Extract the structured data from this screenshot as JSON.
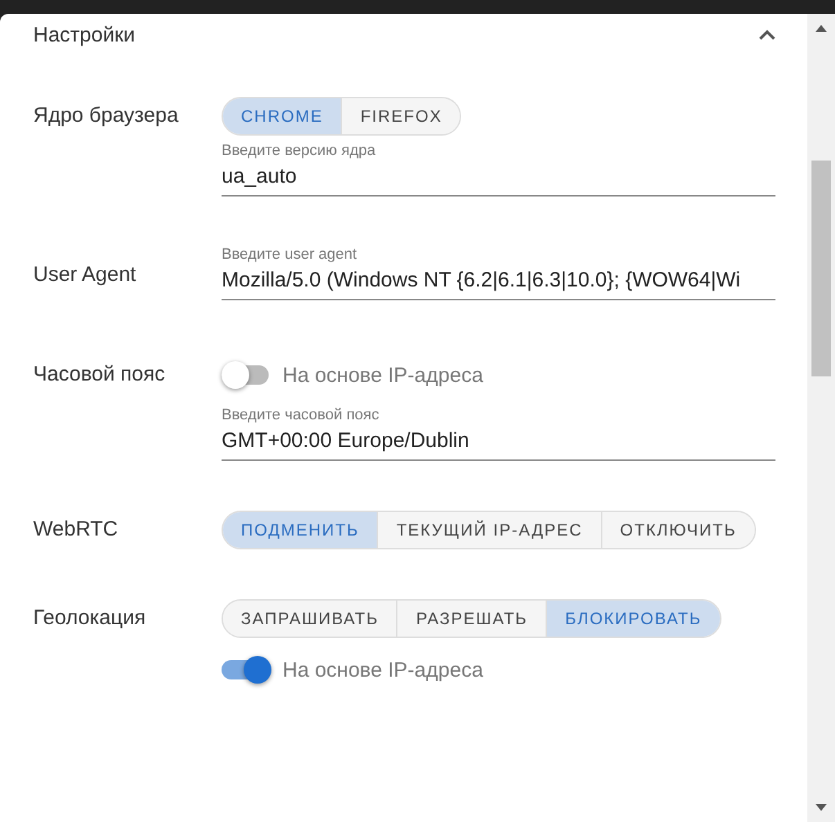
{
  "header": {
    "title": "Настройки",
    "expanded": true
  },
  "rows": [
    {
      "label": "Ядро браузера",
      "controls": [
        {
          "kind": "segmented",
          "options": [
            {
              "label": "CHROME",
              "selected": true
            },
            {
              "label": "FIREFOX",
              "selected": false
            }
          ]
        },
        {
          "kind": "field",
          "label": "Введите версию ядра",
          "value": "ua_auto"
        }
      ]
    },
    {
      "label": "User Agent",
      "controls": [
        {
          "kind": "field",
          "label": "Введите user agent",
          "value": "Mozilla/5.0 (Windows NT {6.2|6.1|6.3|10.0}; {WOW64|Wi"
        }
      ]
    },
    {
      "label": "Часовой пояс",
      "controls": [
        {
          "kind": "toggle",
          "text": "На основе IP-адреса",
          "on": false
        },
        {
          "kind": "field",
          "label": "Введите часовой пояс",
          "value": "GMT+00:00 Europe/Dublin"
        }
      ]
    },
    {
      "label": "WebRTC",
      "controls": [
        {
          "kind": "segmented",
          "options": [
            {
              "label": "ПОДМЕНИТЬ",
              "selected": true
            },
            {
              "label": "ТЕКУЩИЙ IP-АДРЕС",
              "selected": false
            },
            {
              "label": "ОТКЛЮЧИТЬ",
              "selected": false
            }
          ]
        }
      ]
    },
    {
      "label": "Геолокация",
      "controls": [
        {
          "kind": "segmented",
          "options": [
            {
              "label": "ЗАПРАШИВАТЬ",
              "selected": false
            },
            {
              "label": "РАЗРЕШАТЬ",
              "selected": false
            },
            {
              "label": "БЛОКИРОВАТЬ",
              "selected": true
            }
          ]
        },
        {
          "kind": "toggle",
          "text": "На основе IP-адреса",
          "on": true
        }
      ]
    }
  ]
}
